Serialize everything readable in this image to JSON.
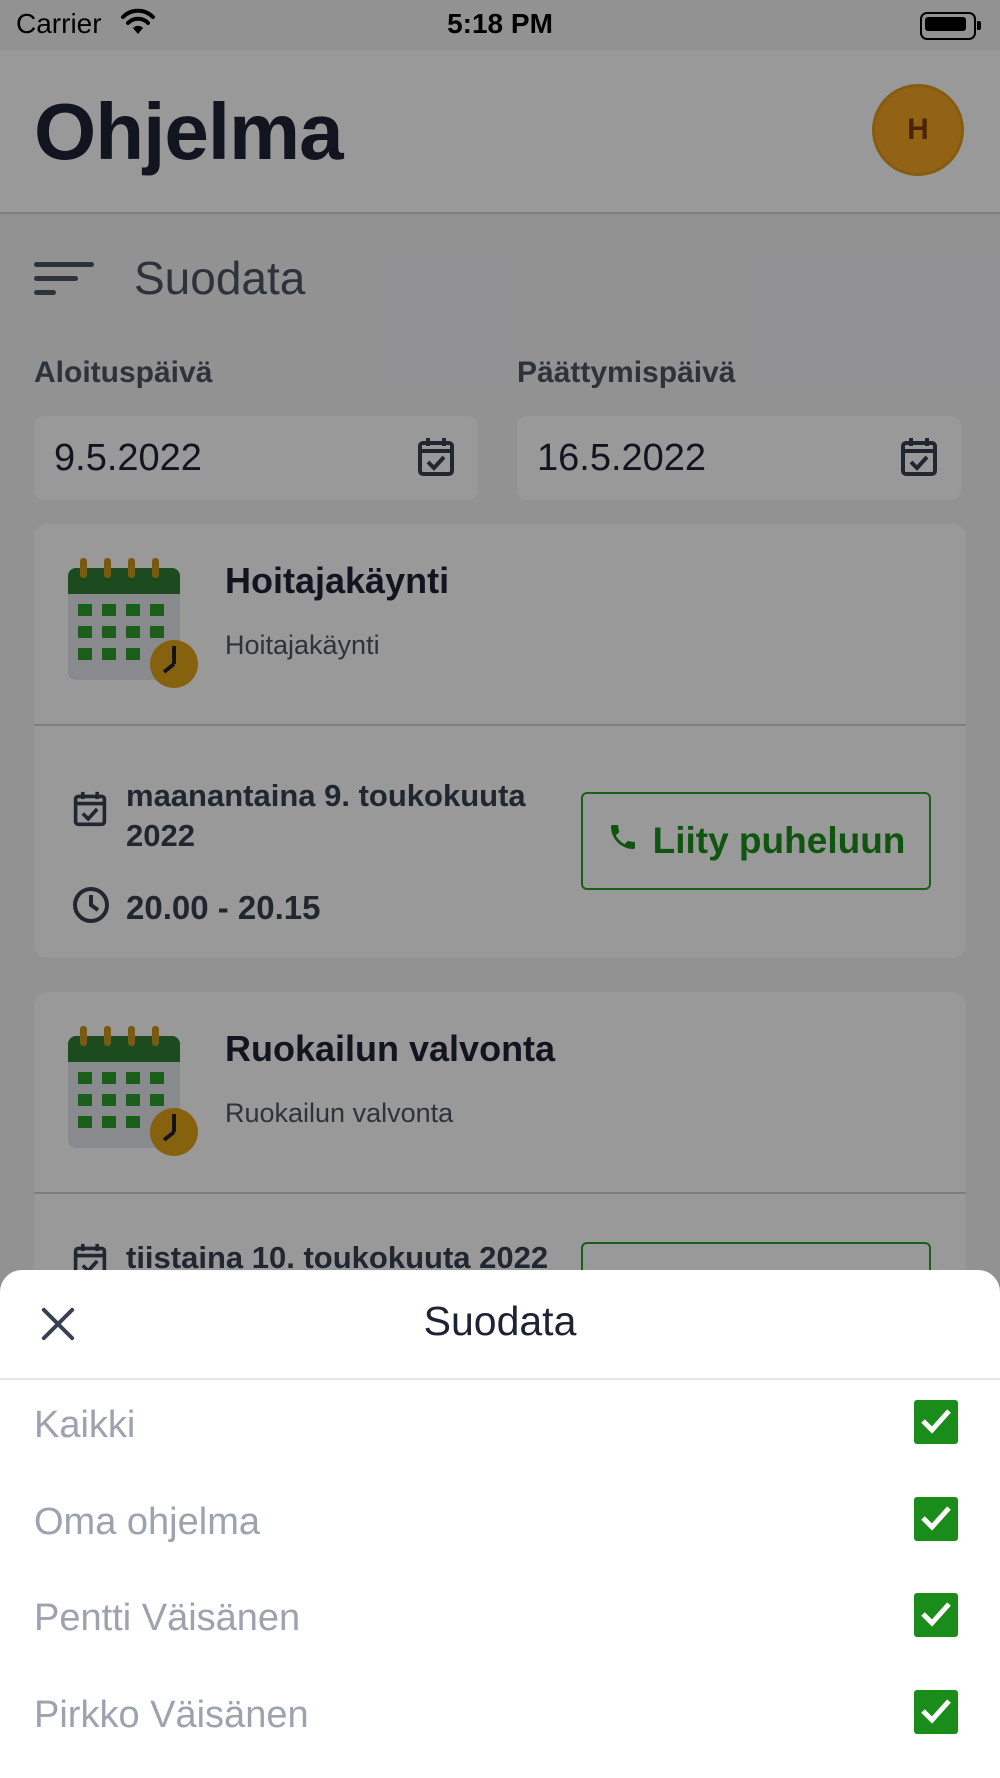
{
  "status_bar": {
    "carrier": "Carrier",
    "time": "5:18 PM"
  },
  "header": {
    "title": "Ohjelma",
    "avatar_initial": "H"
  },
  "filter": {
    "label": "Suodata"
  },
  "dates": {
    "start_label": "Aloituspäivä",
    "start_value": "9.5.2022",
    "end_label": "Päättymispäivä",
    "end_value": "16.5.2022"
  },
  "cards": [
    {
      "title": "Hoitajakäynti",
      "subtitle": "Hoitajakäynti",
      "date": "maanantaina 9. toukokuuta 2022",
      "time": "20.00 - 20.15",
      "join_label": "Liity puheluun"
    },
    {
      "title": "Ruokailun valvonta",
      "subtitle": "Ruokailun valvonta",
      "date": "tiistaina 10. toukokuuta 2022"
    }
  ],
  "sheet": {
    "title": "Suodata",
    "items": [
      {
        "label": "Kaikki",
        "checked": true
      },
      {
        "label": "Oma ohjelma",
        "checked": true
      },
      {
        "label": "Pentti Väisänen",
        "checked": true
      },
      {
        "label": "Pirkko Väisänen",
        "checked": true
      }
    ]
  },
  "colors": {
    "accent_green": "#1a8c1a",
    "avatar": "#f5a623",
    "title": "#1e2235"
  },
  "icons": [
    "wifi-icon",
    "battery-icon",
    "filter-icon",
    "calendar-check-icon",
    "calendar-illustration-icon",
    "clock-icon",
    "phone-icon",
    "close-icon",
    "check-icon"
  ]
}
